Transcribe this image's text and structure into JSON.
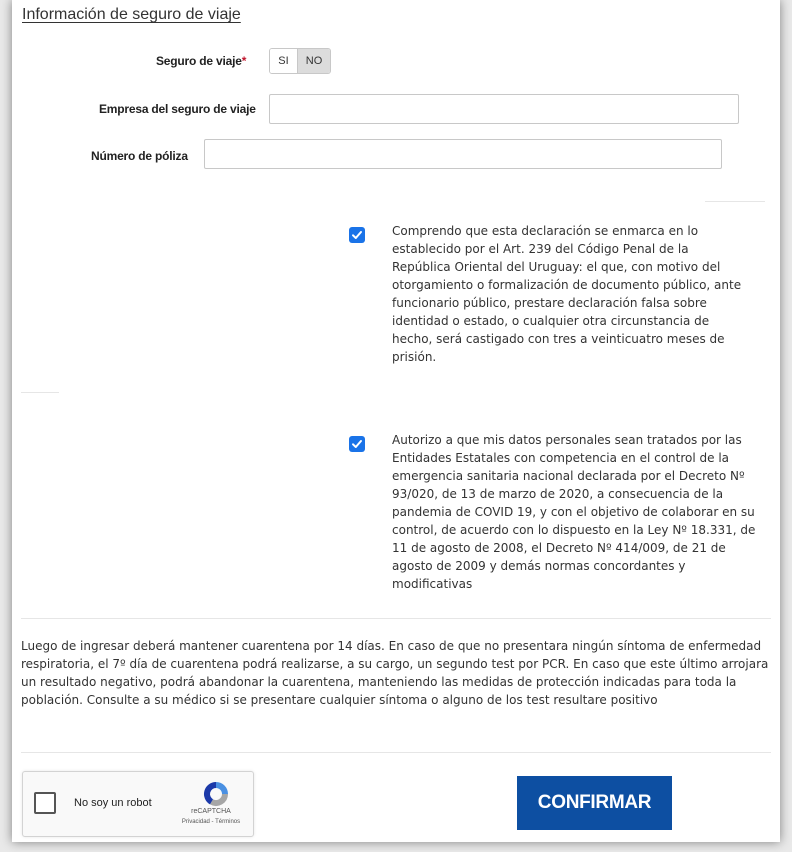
{
  "section": {
    "title": "Información de seguro de viaje"
  },
  "travel_insurance": {
    "label": "Seguro de viaje",
    "required_mark": "*",
    "yes_label": "SI",
    "no_label": "NO",
    "selected": "NO"
  },
  "company": {
    "label": "Empresa del seguro de viaje",
    "value": ""
  },
  "policy": {
    "label": "Número de póliza",
    "value": ""
  },
  "declarations": [
    {
      "checked": true,
      "text": "Comprendo que esta declaración se enmarca en lo establecido por el Art. 239 del Código Penal de la República Oriental del Uruguay: el que, con motivo del otorgamiento o formalización de documento público, ante funcionario público, prestare declaración falsa sobre identidad o estado, o cualquier otra circunstancia de hecho, será castigado con tres a veinticuatro meses de prisión."
    },
    {
      "checked": true,
      "text": "Autorizo a que mis datos personales sean tratados por las Entidades Estatales con competencia en el control de la emergencia sanitaria nacional declarada por el Decreto Nº 93/020, de 13 de marzo de 2020, a consecuencia de la pandemia de COVID 19, y con el objetivo de colaborar en su control, de acuerdo con lo dispuesto en la Ley Nº 18.331, de 11 de agosto de 2008, el Decreto Nº 414/009, de 21 de agosto de 2009 y demás normas concordantes y modificativas"
    }
  ],
  "notice": "Luego de ingresar deberá mantener cuarentena por 14 días. En caso de que no presentara ningún síntoma de enfermedad respiratoria, el 7º día de cuarentena podrá realizarse, a su cargo, un segundo test por PCR. En caso que este último arrojara un resultado negativo, podrá abandonar la cuarentena, manteniendo las medidas de protección indicadas para toda la población. Consulte a su médico si se presentare cualquier síntoma o alguno de los test resultare positivo",
  "recaptcha": {
    "label": "No soy un robot",
    "brand": "reCAPTCHA",
    "links": "Privacidad - Términos",
    "icon": "recaptcha-logo-icon"
  },
  "confirm_label": "CONFIRMAR",
  "colors": {
    "primary": "#0d4fa2",
    "checkbox": "#1a73e8",
    "required": "#c0152d"
  }
}
